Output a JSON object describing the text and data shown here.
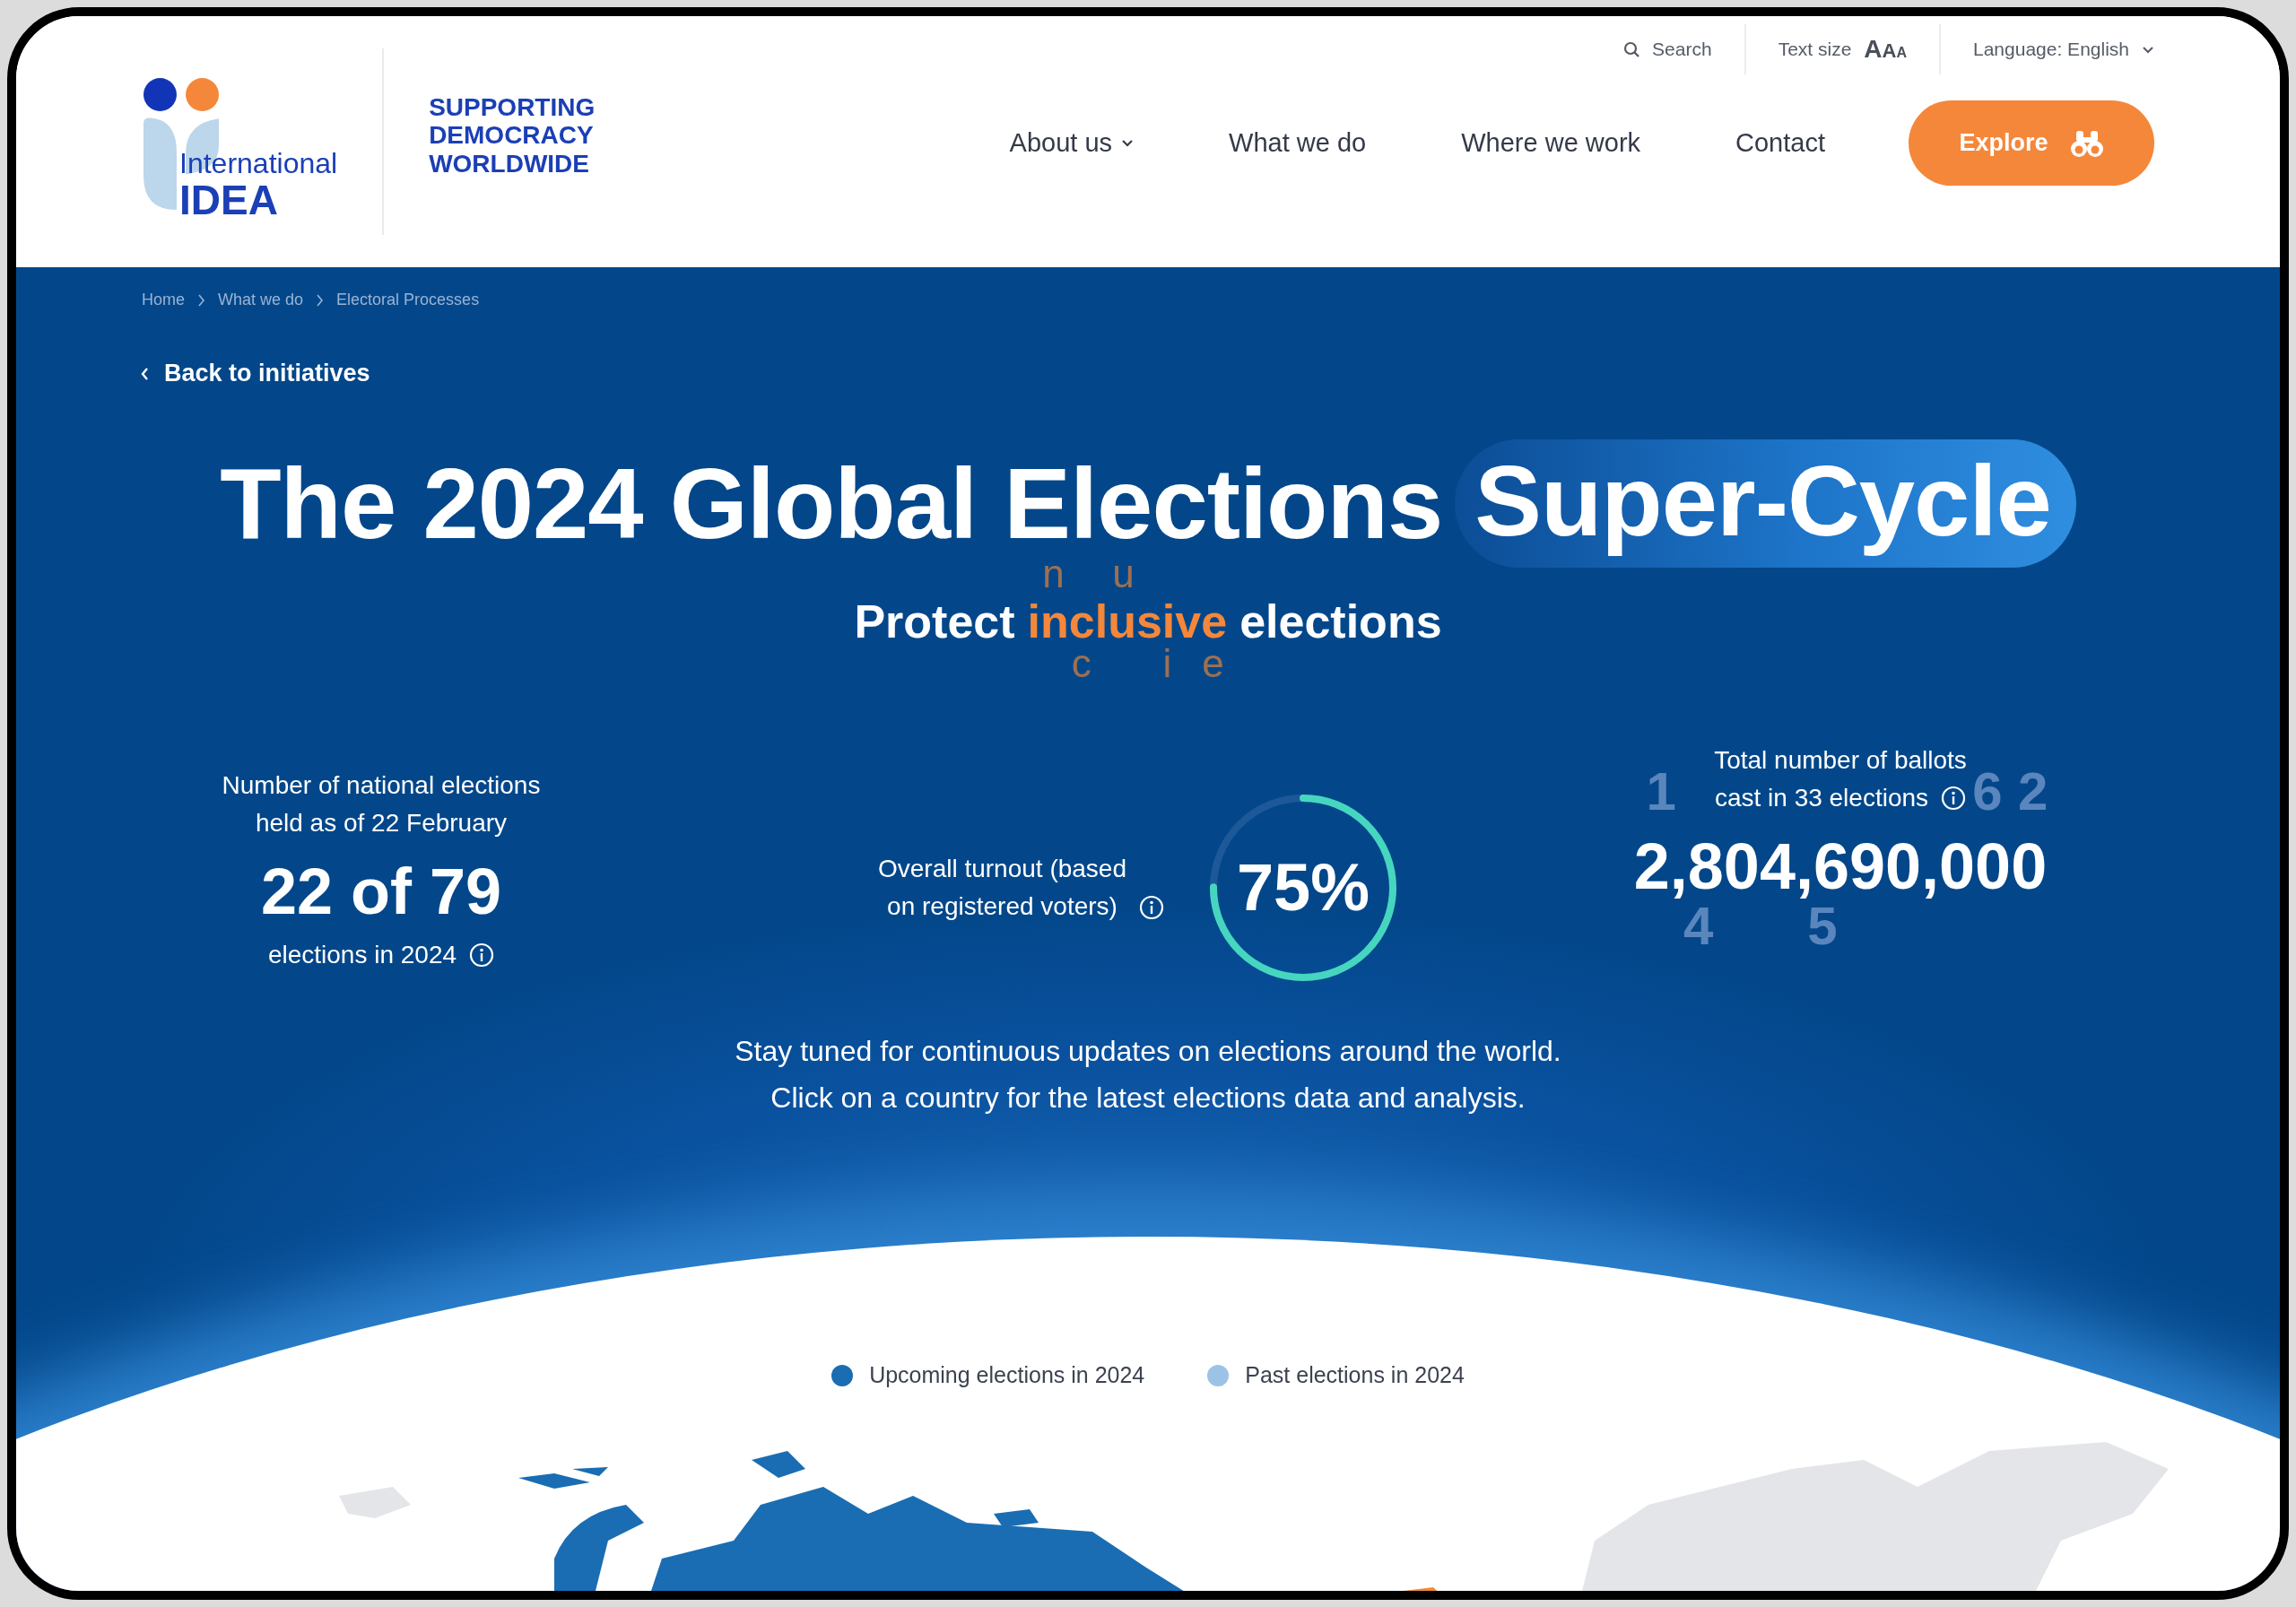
{
  "header": {
    "logo": {
      "line1": "International",
      "line2": "IDEA"
    },
    "tagline": [
      "SUPPORTING",
      "DEMOCRACY",
      "WORLDWIDE"
    ],
    "utility": {
      "search": "Search",
      "text_size_label": "Text size",
      "text_size_glyphs": [
        "A",
        "A",
        "A"
      ],
      "language": "Language: English"
    },
    "nav": [
      {
        "label": "About us",
        "dropdown": true
      },
      {
        "label": "What we do",
        "dropdown": false
      },
      {
        "label": "Where we work",
        "dropdown": false
      },
      {
        "label": "Contact",
        "dropdown": false
      }
    ],
    "cta": "Explore"
  },
  "breadcrumbs": [
    "Home",
    "What we do",
    "Electoral Processes"
  ],
  "back_link": "Back to initiatives",
  "title": {
    "main": "The 2024 Global Elections",
    "highlight": "Super-Cycle"
  },
  "subtitle": {
    "before": "Protect",
    "highlight": "inclusive",
    "after": "elections",
    "ghost_letters": [
      {
        "char": "n",
        "kind": "above"
      },
      {
        "char": "u",
        "kind": "above"
      },
      {
        "char": "c",
        "kind": "below"
      },
      {
        "char": "i",
        "kind": "below"
      },
      {
        "char": "e",
        "kind": "below"
      }
    ]
  },
  "stats": [
    {
      "kind": "count",
      "label_lines": [
        "Number of national elections",
        "held as of 22 February"
      ],
      "value": "22 of 79",
      "note": "elections in 2024"
    },
    {
      "kind": "ring",
      "label_lines": [
        "Overall turnout (based",
        "on registered voters)"
      ],
      "value": "75%",
      "level": 0.75
    },
    {
      "kind": "total",
      "label_lines": [
        "Total number of ballots",
        "cast in 33 elections"
      ],
      "value": "2,804,690,000",
      "ghost_digits": [
        "1",
        "6",
        "2",
        "4",
        "5"
      ]
    }
  ],
  "intro": [
    "Stay tuned for continuous updates on elections around the world.",
    "Click on a country for the latest elections data and analysis."
  ],
  "legend": [
    {
      "label": "Upcoming elections in 2024",
      "color": "#1a6db3"
    },
    {
      "label": "Past elections in 2024",
      "color": "#9cc3e6"
    }
  ]
}
